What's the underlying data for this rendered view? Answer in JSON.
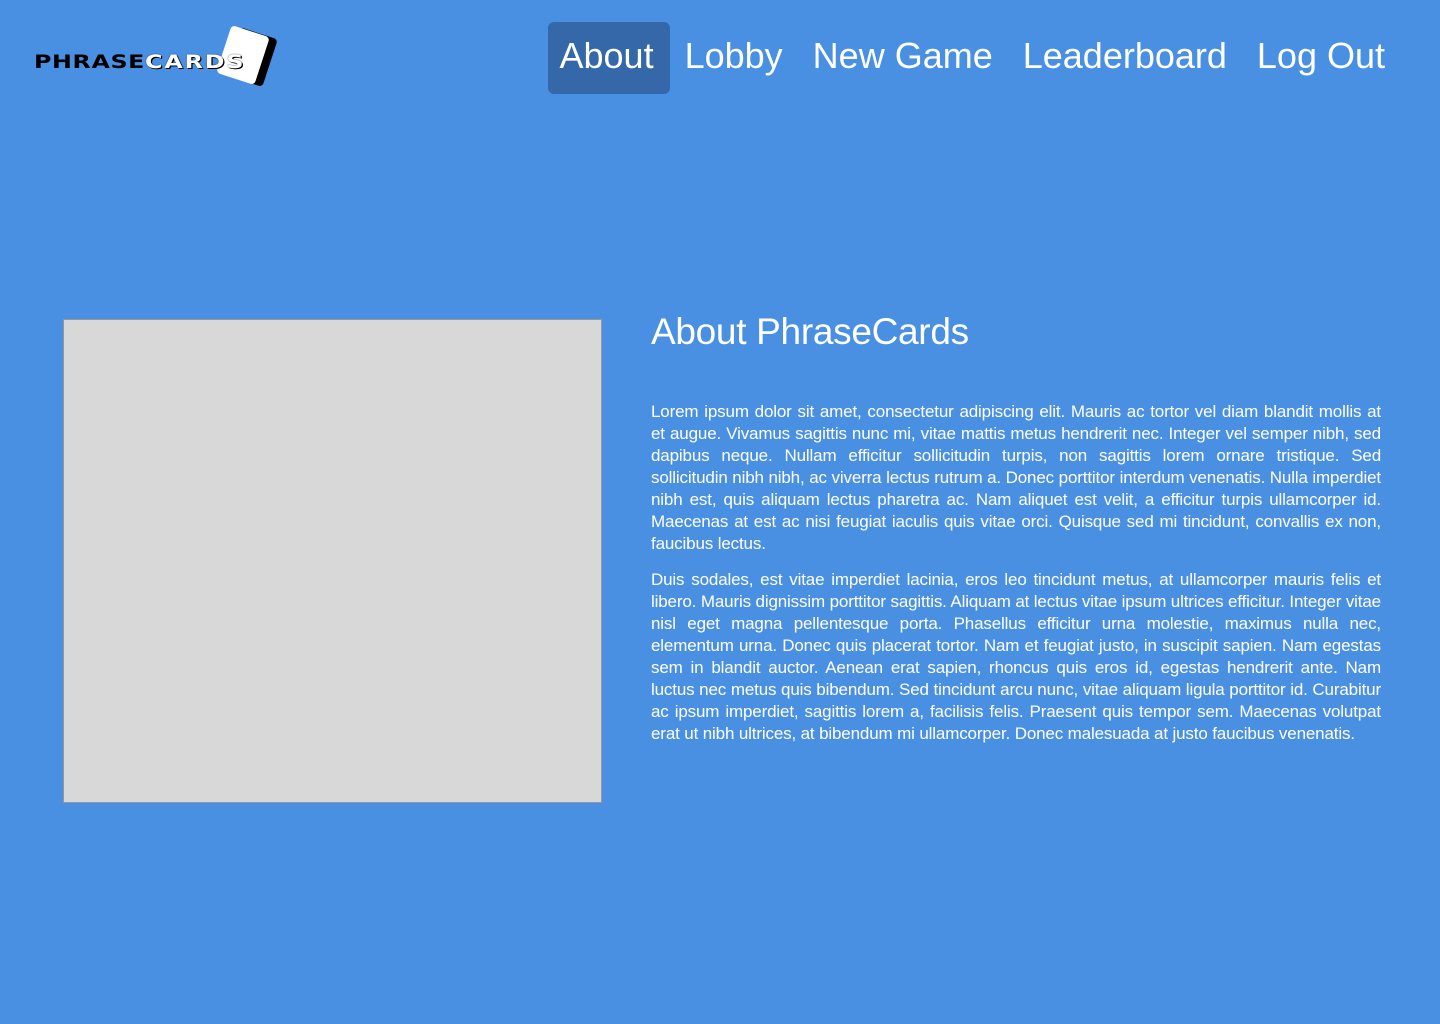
{
  "logo": {
    "text_part1": "PHRASE",
    "text_part2": "CARDS"
  },
  "nav": {
    "items": [
      {
        "label": "About",
        "active": true
      },
      {
        "label": "Lobby",
        "active": false
      },
      {
        "label": "New Game",
        "active": false
      },
      {
        "label": "Leaderboard",
        "active": false
      },
      {
        "label": "Log Out",
        "active": false
      }
    ]
  },
  "about": {
    "title": "About PhraseCards",
    "paragraphs": [
      "Lorem ipsum dolor sit amet, consectetur adipiscing elit. Mauris ac tortor vel diam blandit mollis at et augue. Vivamus sagittis nunc mi, vitae mattis metus hendrerit nec. Integer vel semper nibh, sed dapibus neque. Nullam efficitur sollicitudin turpis, non sagittis lorem ornare tristique. Sed sollicitudin nibh nibh, ac viverra lectus rutrum a. Donec porttitor interdum venenatis. Nulla imperdiet nibh est, quis aliquam lectus pharetra ac. Nam aliquet est velit, a efficitur turpis ullamcorper id. Maecenas at est ac nisi feugiat iaculis quis vitae orci. Quisque sed mi tincidunt, convallis ex non, faucibus lectus.",
      "Duis sodales, est vitae imperdiet lacinia, eros leo tincidunt metus, at ullamcorper mauris felis et libero. Mauris dignissim porttitor sagittis. Aliquam at lectus vitae ipsum ultrices efficitur. Integer vitae nisl eget magna pellentesque porta. Phasellus efficitur urna molestie, maximus nulla nec, elementum urna. Donec quis placerat tortor. Nam et feugiat justo, in suscipit sapien. Nam egestas sem in blandit auctor. Aenean erat sapien, rhoncus quis eros id, egestas hendrerit ante. Nam luctus nec metus quis bibendum. Sed tincidunt arcu nunc, vitae aliquam ligula porttitor id. Curabitur ac ipsum imperdiet, sagittis lorem a, facilisis felis. Praesent quis tempor sem. Maecenas volutpat erat ut nibh ultrices, at bibendum mi ullamcorper. Donec malesuada at justo faucibus venenatis."
    ]
  },
  "colors": {
    "background": "#4a90e2",
    "nav_active": "#3468a8",
    "placeholder": "#d8d8d8",
    "placeholder_border": "#979797",
    "text": "#ffffff"
  }
}
